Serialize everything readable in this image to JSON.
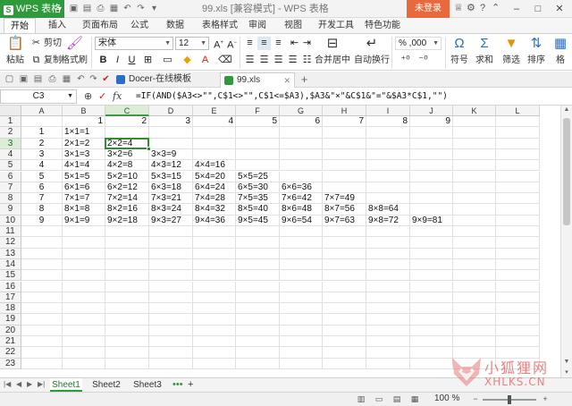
{
  "titlebar": {
    "app_name": "WPS 表格",
    "window_title": "99.xls [兼容模式] - WPS 表格",
    "login_label": "未登录"
  },
  "ribbon_tabs": [
    "开始",
    "插入",
    "页面布局",
    "公式",
    "数据",
    "表格样式",
    "审阅",
    "视图",
    "开发工具",
    "特色功能"
  ],
  "ribbon": {
    "paste": "粘贴",
    "cut": "剪切",
    "copy": "复制",
    "format_painter": "格式刷",
    "font_name": "宋体",
    "font_size": "12",
    "merge_center": "合并居中",
    "auto_wrap": "自动换行",
    "symbol": "符号",
    "sum": "求和",
    "filter": "筛选",
    "sort": "排序",
    "format": "格",
    "number_format": "% ,000"
  },
  "doc_tabs": [
    {
      "label": "Docer-在线模板"
    },
    {
      "label": "99.xls"
    }
  ],
  "formula_bar": {
    "name_box": "C3",
    "fx": "fx",
    "formula": "=IF(AND($A3<>\"\",C$1<>\"\",C$1<=$A3),$A3&\"×\"&C$1&\"=\"&$A3*C$1,\"\")"
  },
  "columns": [
    "A",
    "B",
    "C",
    "D",
    "E",
    "F",
    "G",
    "H",
    "I",
    "J",
    "K",
    "L"
  ],
  "rows": [
    "1",
    "2",
    "3",
    "4",
    "5",
    "6",
    "7",
    "8",
    "9",
    "10",
    "11",
    "12",
    "13",
    "14",
    "15",
    "16",
    "17",
    "18",
    "19",
    "20",
    "21",
    "22",
    "23"
  ],
  "cells": {
    "row1": [
      "",
      "1",
      "2",
      "3",
      "4",
      "5",
      "6",
      "7",
      "8",
      "9"
    ],
    "row2": [
      "1",
      "1×1=1",
      "",
      "",
      "",
      "",
      "",
      "",
      "",
      ""
    ],
    "row3": [
      "2",
      "2×1=2",
      "2×2=4",
      "",
      "",
      "",
      "",
      "",
      "",
      ""
    ],
    "row4": [
      "3",
      "3×1=3",
      "3×2=6",
      "3×3=9",
      "",
      "",
      "",
      "",
      "",
      ""
    ],
    "row5": [
      "4",
      "4×1=4",
      "4×2=8",
      "4×3=12",
      "4×4=16",
      "",
      "",
      "",
      "",
      ""
    ],
    "row6": [
      "5",
      "5×1=5",
      "5×2=10",
      "5×3=15",
      "5×4=20",
      "5×5=25",
      "",
      "",
      "",
      ""
    ],
    "row7": [
      "6",
      "6×1=6",
      "6×2=12",
      "6×3=18",
      "6×4=24",
      "6×5=30",
      "6×6=36",
      "",
      "",
      ""
    ],
    "row8": [
      "7",
      "7×1=7",
      "7×2=14",
      "7×3=21",
      "7×4=28",
      "7×5=35",
      "7×6=42",
      "7×7=49",
      "",
      ""
    ],
    "row9": [
      "8",
      "8×1=8",
      "8×2=16",
      "8×3=24",
      "8×4=32",
      "8×5=40",
      "8×6=48",
      "8×7=56",
      "8×8=64",
      ""
    ],
    "row10": [
      "9",
      "9×1=9",
      "9×2=18",
      "9×3=27",
      "9×4=36",
      "9×5=45",
      "9×6=54",
      "9×7=63",
      "9×8=72",
      "9×9=81"
    ]
  },
  "sheets": [
    "Sheet1",
    "Sheet2",
    "Sheet3"
  ],
  "status": {
    "zoom": "100 %"
  },
  "watermark": {
    "line1": "小狐狸网",
    "line2": "XHLKS.CN"
  },
  "colors": {
    "accent": "#2f9a3c",
    "login": "#e8693d",
    "active_cell_border": "#2f8f2f"
  }
}
